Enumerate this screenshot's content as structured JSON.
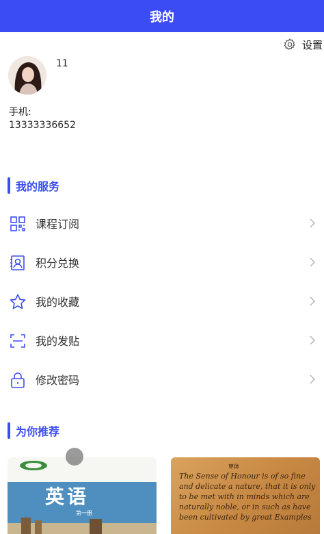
{
  "header": {
    "title": "我的"
  },
  "settings": {
    "label": "设置"
  },
  "profile": {
    "username": "11",
    "phone_label": "手机:",
    "phone_value": "13333336652"
  },
  "services": {
    "title": "我的服务",
    "items": [
      {
        "label": "课程订阅",
        "icon": "grid-icon"
      },
      {
        "label": "积分兑换",
        "icon": "id-card-icon"
      },
      {
        "label": "我的收藏",
        "icon": "star-icon"
      },
      {
        "label": "我的发贴",
        "icon": "scan-frame-icon"
      },
      {
        "label": "修改密码",
        "icon": "lock-icon"
      }
    ]
  },
  "recommend": {
    "title": "为你推荐",
    "cards": [
      {
        "title": "英语",
        "subtitle": "第一册"
      },
      {
        "heading": "草体",
        "text": "The Sense of Honour is of so fine and delicate a nature, that it is only to be met with in minds which are naturally noble, or in such as have been cultivated by great Examples"
      }
    ]
  },
  "colors": {
    "accent": "#3b4cf5",
    "icon": "#3b4cf5"
  }
}
